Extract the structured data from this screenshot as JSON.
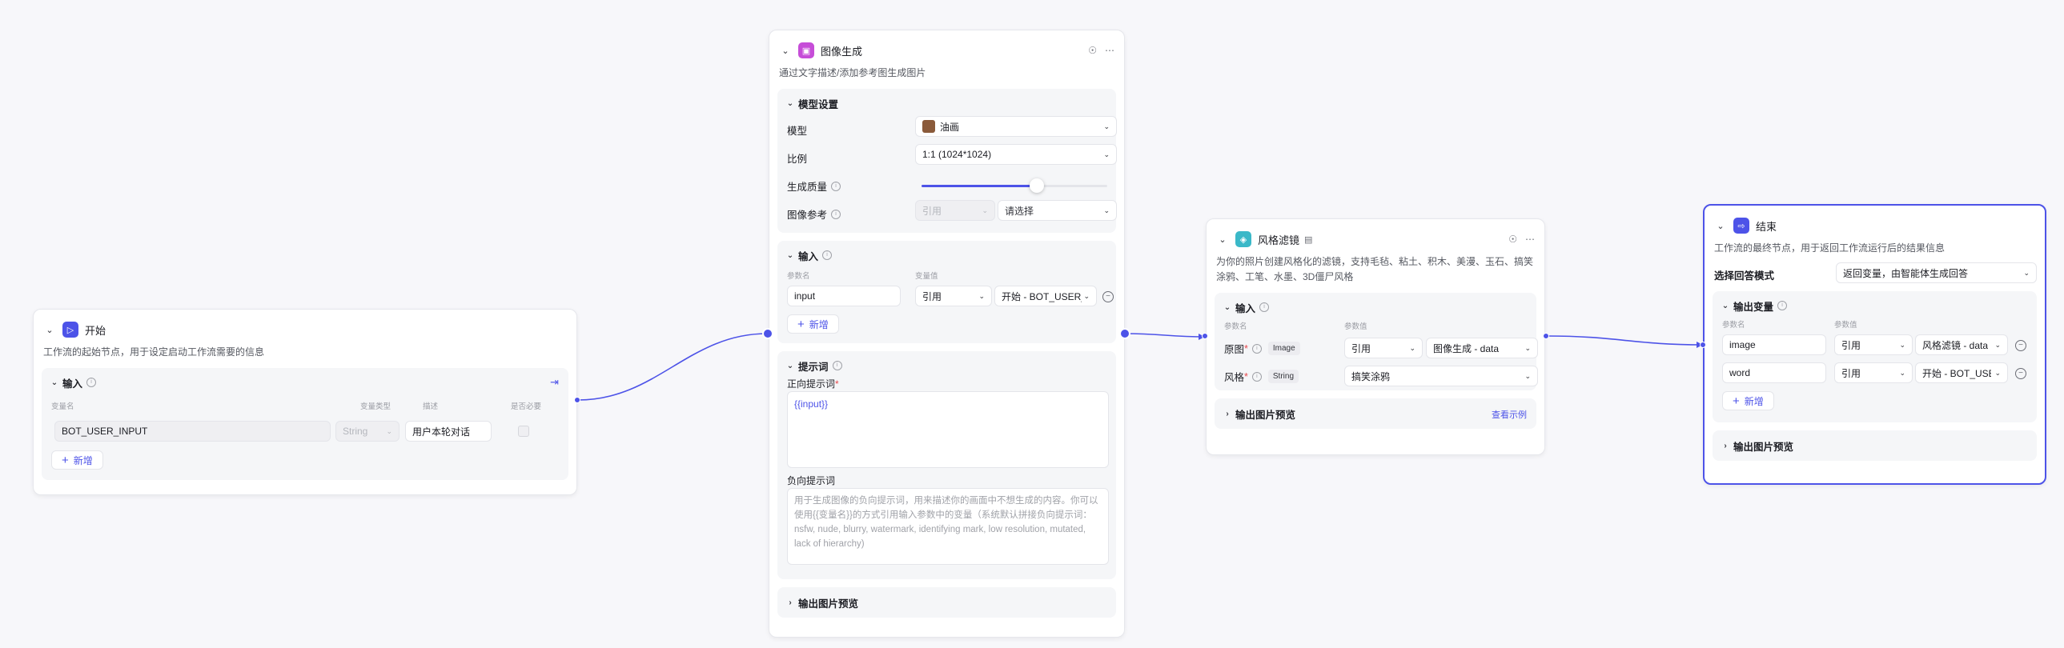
{
  "start_node": {
    "title": "开始",
    "desc": "工作流的起始节点，用于设定启动工作流需要的信息",
    "input_title": "输入",
    "col_var_name": "变量名",
    "col_var_type": "变量类型",
    "col_desc": "描述",
    "col_required": "是否必要",
    "var_name": "BOT_USER_INPUT",
    "var_type": "String",
    "var_desc": "用户本轮对话",
    "add_label": "新增",
    "icon": "play-icon",
    "icon_color": "#4d53e8"
  },
  "image_node": {
    "title": "图像生成",
    "desc": "通过文字描述/添加参考图生成图片",
    "model_section": "模型设置",
    "model_label": "模型",
    "model_value": "油画",
    "ratio_label": "比例",
    "ratio_value": "1:1 (1024*1024)",
    "quality_label": "生成质量",
    "quality_level": 0.62,
    "ref_label": "图像参考",
    "ref_mode": "引用",
    "ref_placeholder": "请选择",
    "input_section": "输入",
    "col_param": "参数名",
    "col_value": "变量值",
    "input_name": "input",
    "input_mode": "引用",
    "input_ref": "开始 - BOT_USER_INPUT",
    "add_label": "新增",
    "prompt_section": "提示词",
    "pos_label": "正向提示词",
    "pos_value": "{{input}}",
    "neg_label": "负向提示词",
    "neg_placeholder": "用于生成图像的负向提示词，用来描述你的画面中不想生成的内容。你可以使用{{变量名}}的方式引用输入参数中的变量（系统默认拼接负向提示词：nsfw, nude, blurry, watermark, identifying mark, low resolution, mutated, lack of hierarchy)",
    "output_section": "输出图片预览",
    "icon": "image-gen-icon",
    "icon_color": "#c64dd8"
  },
  "filter_node": {
    "title": "风格滤镜",
    "desc": "为你的照片创建风格化的滤镜，支持毛毡、粘土、积木、美漫、玉石、搞笑涂鸦、工笔、水墨、3D僵尸风格",
    "input_section": "输入",
    "col_param": "参数名",
    "col_value": "参数值",
    "row1_name": "原图",
    "row1_type": "Image",
    "row1_mode": "引用",
    "row1_ref": "图像生成 - data",
    "row2_name": "风格",
    "row2_type": "String",
    "row2_value": "搞笑涂鸦",
    "output_section": "输出图片预览",
    "example_link": "查看示例",
    "icon": "filter-icon",
    "icon_color": "#3ab8c8"
  },
  "end_node": {
    "title": "结束",
    "desc": "工作流的最终节点，用于返回工作流运行后的结果信息",
    "mode_label": "选择回答模式",
    "mode_value": "返回变量，由智能体生成回答",
    "output_section": "输出变量",
    "col_param": "参数名",
    "col_value": "参数值",
    "row1_name": "image",
    "row1_mode": "引用",
    "row1_ref": "风格滤镜 - data",
    "row2_name": "word",
    "row2_mode": "引用",
    "row2_ref": "开始 - BOT_USER_INPUT",
    "add_label": "新增",
    "preview_section": "输出图片预览",
    "icon": "exit-icon",
    "icon_color": "#4d53e8"
  }
}
